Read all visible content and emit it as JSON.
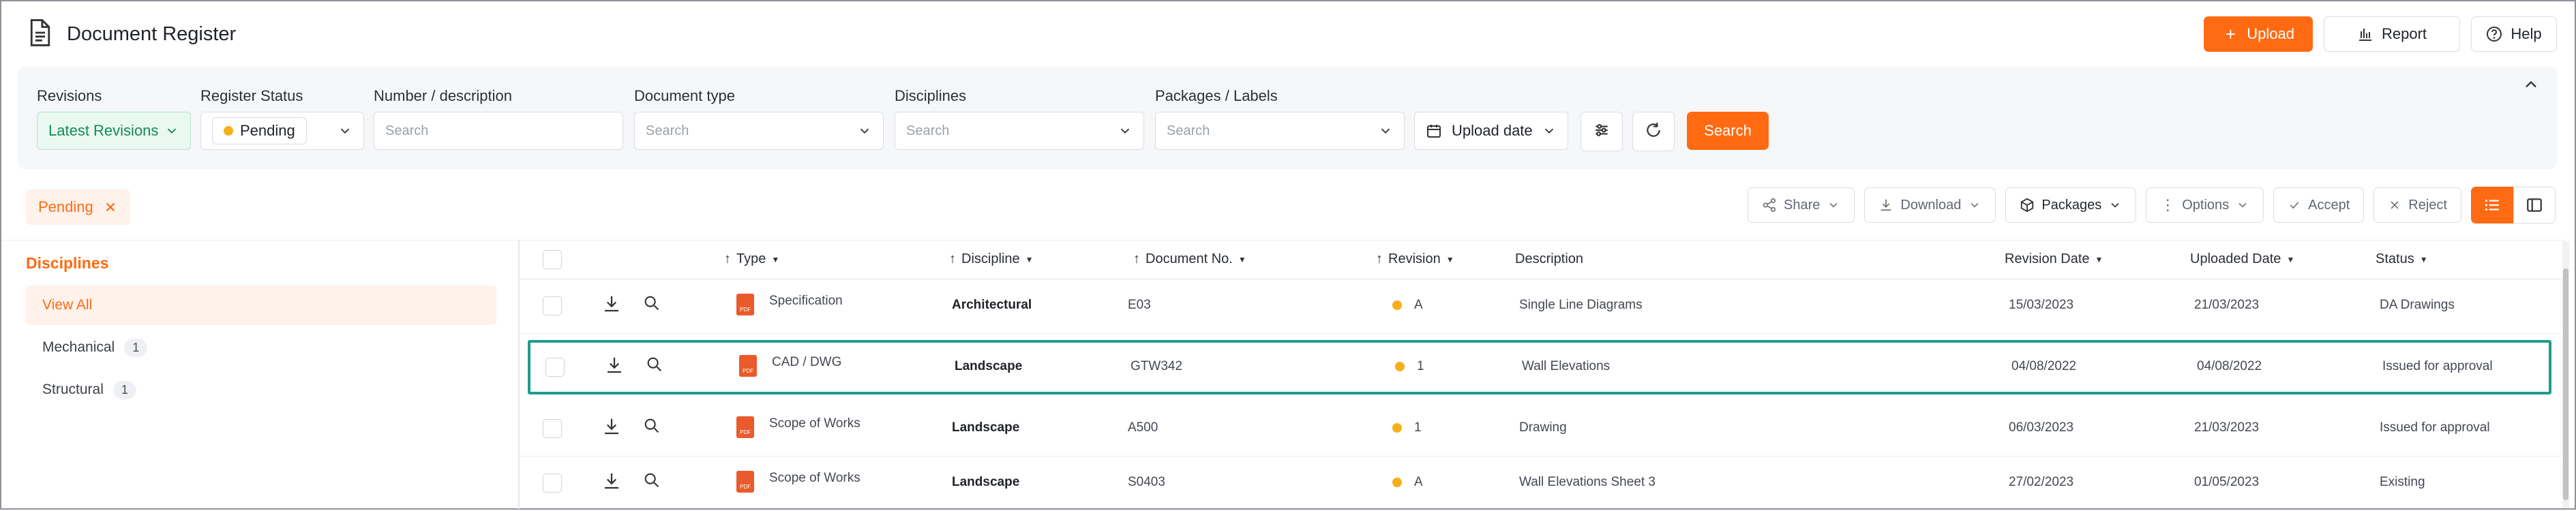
{
  "header": {
    "title": "Document Register",
    "actions": {
      "upload": "Upload",
      "report": "Report",
      "help": "Help"
    }
  },
  "filters": {
    "revisions_label": "Revisions",
    "revisions_value": "Latest Revisions",
    "register_status_label": "Register Status",
    "register_status_value": "Pending",
    "number_label": "Number / description",
    "number_placeholder": "Search",
    "doc_type_label": "Document type",
    "doc_type_placeholder": "Search",
    "disciplines_label": "Disciplines",
    "disciplines_placeholder": "Search",
    "packages_label": "Packages / Labels",
    "packages_placeholder": "Search",
    "upload_date": "Upload date",
    "search_button": "Search"
  },
  "applied_filter": {
    "label": "Pending"
  },
  "toolbar": {
    "share": "Share",
    "download": "Download",
    "packages": "Packages",
    "options": "Options",
    "accept": "Accept",
    "reject": "Reject"
  },
  "sidebar": {
    "title": "Disciplines",
    "items": [
      {
        "label": "View All",
        "count": ""
      },
      {
        "label": "Mechanical",
        "count": "1"
      },
      {
        "label": "Structural",
        "count": "1"
      }
    ]
  },
  "table": {
    "columns": {
      "type": "Type",
      "discipline": "Discipline",
      "document_no": "Document No.",
      "revision": "Revision",
      "description": "Description",
      "revision_date": "Revision Date",
      "uploaded_date": "Uploaded Date",
      "status": "Status"
    },
    "rows": [
      {
        "type": "Specification",
        "discipline": "Architectural",
        "doc_no": "E03",
        "revision": "A",
        "description": "Single Line Diagrams",
        "revision_date": "15/03/2023",
        "uploaded_date": "21/03/2023",
        "status": "DA Drawings"
      },
      {
        "type": "CAD / DWG",
        "discipline": "Landscape",
        "doc_no": "GTW342",
        "revision": "1",
        "description": "Wall Elevations",
        "revision_date": "04/08/2022",
        "uploaded_date": "04/08/2022",
        "status": "Issued for approval"
      },
      {
        "type": "Scope of Works",
        "discipline": "Landscape",
        "doc_no": "A500",
        "revision": "1",
        "description": "Drawing",
        "revision_date": "06/03/2023",
        "uploaded_date": "21/03/2023",
        "status": "Issued for approval"
      },
      {
        "type": "Scope of Works",
        "discipline": "Landscape",
        "doc_no": "S0403",
        "revision": "A",
        "description": "Wall Elevations Sheet 3",
        "revision_date": "27/02/2023",
        "uploaded_date": "01/05/2023",
        "status": "Existing"
      }
    ],
    "pdf_badge": "PDF"
  },
  "colors": {
    "accent": "#ff6a13",
    "highlight": "#1f9c8f",
    "pending_dot": "#f5b019",
    "latest_revisions_green": "#138a59"
  }
}
